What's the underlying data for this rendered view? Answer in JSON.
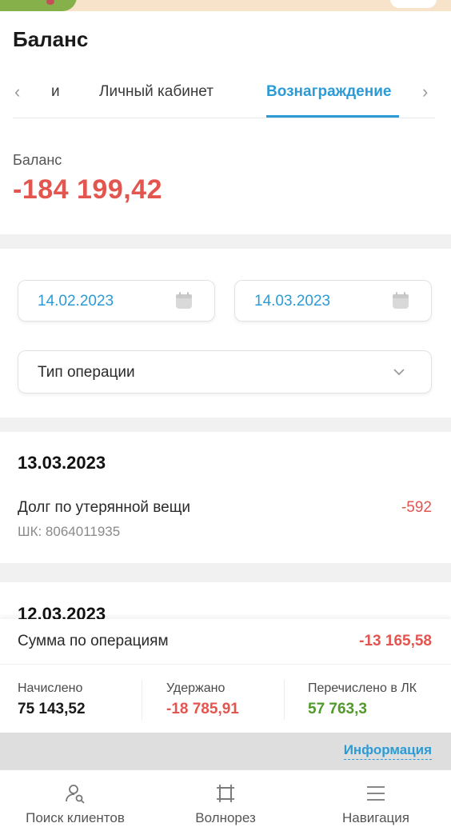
{
  "header": {
    "title": "Баланс"
  },
  "tabs": {
    "items": [
      {
        "label": "и"
      },
      {
        "label": "Личный кабинет"
      },
      {
        "label": "Вознаграждение"
      }
    ],
    "active_index": 2
  },
  "balance": {
    "label": "Баланс",
    "value": "-184 199,42"
  },
  "filters": {
    "date_from": "14.02.2023",
    "date_to": "14.03.2023",
    "operation_type_placeholder": "Тип операции"
  },
  "operations": [
    {
      "date": "13.03.2023",
      "name": "Долг по утерянной вещи",
      "code": "ШК: 8064011935",
      "amount": "-592"
    },
    {
      "date": "12.03.2023"
    }
  ],
  "summary": {
    "total_label": "Сумма по операциям",
    "total_value": "-13 165,58",
    "accrued_label": "Начислено",
    "accrued_value": "75 143,52",
    "withheld_label": "Удержано",
    "withheld_value": "-18 785,91",
    "transferred_label": "Перечислено в ЛК",
    "transferred_value": "57 763,3"
  },
  "info_link": "Информация",
  "bottom_nav": [
    {
      "label": "Поиск клиентов",
      "icon": "user-search-icon"
    },
    {
      "label": "Волнорез",
      "icon": "crop-icon"
    },
    {
      "label": "Навигация",
      "icon": "menu-icon"
    }
  ],
  "colors": {
    "accent": "#2c9bd5",
    "negative": "#e3554f",
    "positive": "#4f9a2a"
  }
}
